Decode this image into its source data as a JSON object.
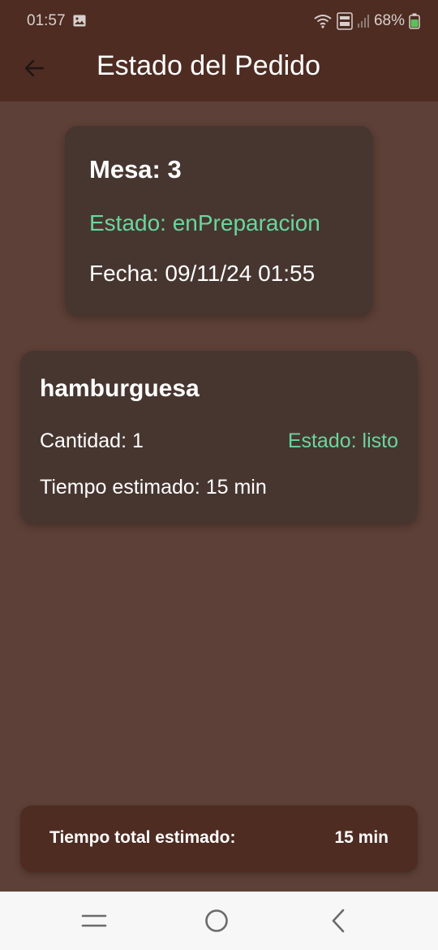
{
  "status_bar": {
    "time": "01:57",
    "battery": "68%",
    "icons": [
      "gallery-icon",
      "wifi-icon",
      "volte-icon",
      "signal-icon",
      "battery-icon"
    ]
  },
  "app_bar": {
    "title": "Estado del Pedido",
    "back_icon": "arrow-left-icon"
  },
  "order": {
    "mesa": "Mesa: 3",
    "estado": "Estado: enPreparacion",
    "fecha": "Fecha: 09/11/24 01:55"
  },
  "items": [
    {
      "name": "hamburguesa",
      "cantidad": "Cantidad: 1",
      "estado": "Estado: listo",
      "tiempo": "Tiempo estimado: 15 min"
    }
  ],
  "total": {
    "label": "Tiempo total estimado:",
    "value": "15 min"
  },
  "nav_bar": {
    "icons": [
      "recent-apps-icon",
      "home-icon",
      "back-icon"
    ]
  },
  "colors": {
    "background": "#5d4037",
    "app_bar": "#4e2c22",
    "card": "#473630",
    "status_green": "#6ad69c",
    "nav_bar": "#f7f7f7"
  }
}
